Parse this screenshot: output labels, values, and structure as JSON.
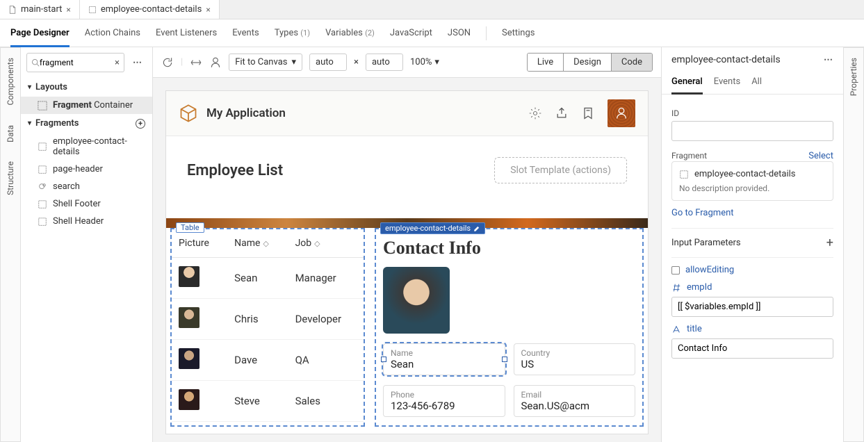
{
  "tabs": [
    {
      "label": "main-start"
    },
    {
      "label": "employee-contact-details"
    }
  ],
  "subnav": {
    "items": [
      {
        "label": "Page Designer",
        "active": true
      },
      {
        "label": "Action Chains"
      },
      {
        "label": "Event Listeners"
      },
      {
        "label": "Events"
      },
      {
        "label": "Types",
        "count": "(1)"
      },
      {
        "label": "Variables",
        "count": "(2)"
      },
      {
        "label": "JavaScript"
      },
      {
        "label": "JSON"
      },
      {
        "label": "Settings",
        "sep_before": true
      }
    ]
  },
  "left_rail": [
    "Components",
    "Data",
    "Structure"
  ],
  "right_rail": [
    "Properties"
  ],
  "sidebar": {
    "search_value": "fragment",
    "sections": {
      "layouts": {
        "title": "Layouts",
        "items": [
          {
            "label_prefix": "Fragment",
            "label_rest": " Container",
            "hl": true
          }
        ]
      },
      "fragments": {
        "title": "Fragments",
        "items": [
          {
            "icon": "frag",
            "label": "employee-contact-details"
          },
          {
            "icon": "frag",
            "label": "page-header"
          },
          {
            "icon": "search",
            "label": "search"
          },
          {
            "icon": "frag",
            "label": "Shell Footer"
          },
          {
            "icon": "frag",
            "label": "Shell Header"
          }
        ]
      }
    }
  },
  "toolbar": {
    "fit_label": "Fit to Canvas",
    "w": "auto",
    "h": "auto",
    "zoom": "100%",
    "modes": [
      "Live",
      "Design",
      "Code"
    ],
    "active_mode": "Code"
  },
  "preview": {
    "app_title": "My Application",
    "page_heading": "Employee List",
    "slot_text": "Slot Template (actions)",
    "table": {
      "chip": "Table",
      "cols": [
        "Picture",
        "Name",
        "Job"
      ],
      "rows": [
        {
          "name": "Sean",
          "job": "Manager"
        },
        {
          "name": "Chris",
          "job": "Developer"
        },
        {
          "name": "Dave",
          "job": "QA"
        },
        {
          "name": "Steve",
          "job": "Sales"
        }
      ]
    },
    "fragment": {
      "chip": "employee-contact-details",
      "heading": "Contact Info",
      "fields": [
        {
          "label": "Name",
          "value": "Sean"
        },
        {
          "label": "Country",
          "value": "US"
        },
        {
          "label": "Phone",
          "value": "123-456-6789"
        },
        {
          "label": "Email",
          "value": "Sean.US@acm"
        }
      ]
    }
  },
  "props": {
    "title": "employee-contact-details",
    "tabs": [
      "General",
      "Events",
      "All"
    ],
    "id_label": "ID",
    "id_value": "",
    "fragment_label": "Fragment",
    "select_label": "Select",
    "frag_name": "employee-contact-details",
    "frag_desc": "No description provided.",
    "goto_label": "Go to Fragment",
    "params_label": "Input Parameters",
    "param_allow": "allowEditing",
    "param_id": "empId",
    "param_id_val": "[[ $variables.empId ]]",
    "param_title": "title",
    "param_title_val": "Contact Info"
  }
}
